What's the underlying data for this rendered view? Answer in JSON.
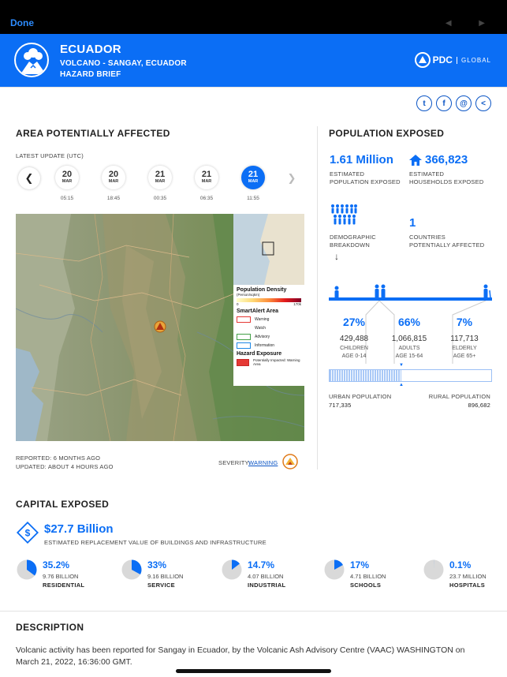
{
  "topbar": {
    "done_label": "Done"
  },
  "header": {
    "title": "ECUADOR",
    "subtitle": "VOLCANO - SANGAY, ECUADOR",
    "subtitle2": "HAZARD BRIEF",
    "brand": "PDC",
    "brand_tag": "GLOBAL"
  },
  "share": {
    "twitter": "t",
    "facebook": "f",
    "email": "@",
    "share": "<"
  },
  "area": {
    "title": "AREA POTENTIALLY AFFECTED",
    "latest_update": "LATEST UPDATE (UTC)",
    "timeline": [
      {
        "day": "20",
        "month": "MAR",
        "time": "05:15",
        "active": false
      },
      {
        "day": "20",
        "month": "MAR",
        "time": "18:45",
        "active": false
      },
      {
        "day": "21",
        "month": "MAR",
        "time": "00:35",
        "active": false
      },
      {
        "day": "21",
        "month": "MAR",
        "time": "06:35",
        "active": false
      },
      {
        "day": "21",
        "month": "MAR",
        "time": "11:55",
        "active": true
      }
    ],
    "reported": "REPORTED: 6 MONTHS AGO",
    "updated": "UPDATED: ABOUT 4 HOURS AGO",
    "severity_label": "SEVERITY:",
    "severity_value": "WARNING"
  },
  "legend": {
    "pop_density": "Population Density",
    "pop_unit": "(Person/sqkm)",
    "scale_min": "0",
    "scale_max": "170k",
    "smartalert": "SmartAlert Area",
    "items": [
      {
        "label": "Warning",
        "color": "#e53935"
      },
      {
        "label": "Watch",
        "color": "#ffffff"
      },
      {
        "label": "Advisory",
        "color": "#43a047"
      },
      {
        "label": "Information",
        "color": "#1e88e5"
      }
    ],
    "hazard_exposure": "Hazard Exposure",
    "impacted_label": "Potentially Impacted: Warning Area"
  },
  "population": {
    "title": "POPULATION EXPOSED",
    "estimated_value": "1.61 Million",
    "estimated_label": "ESTIMATED POPULATION EXPOSED",
    "households_value": "366,823",
    "households_label": "ESTIMATED HOUSEHOLDS EXPOSED",
    "demographic_label": "DEMOGRAPHIC BREAKDOWN",
    "countries_value": "1",
    "countries_label": "COUNTRIES POTENTIALLY AFFECTED",
    "ages": [
      {
        "pct": "27%",
        "count": "429,488",
        "group": "CHILDREN",
        "range": "AGE 0-14"
      },
      {
        "pct": "66%",
        "count": "1,066,815",
        "group": "ADULTS",
        "range": "AGE 15-64"
      },
      {
        "pct": "7%",
        "count": "117,713",
        "group": "ELDERLY",
        "range": "AGE 65+"
      }
    ],
    "urban_label": "URBAN POPULATION",
    "urban_value": "717,335",
    "rural_label": "RURAL POPULATION",
    "rural_value": "896,682",
    "urban_fraction": 0.444
  },
  "capital": {
    "title": "CAPITAL EXPOSED",
    "total": "$27.7 Billion",
    "total_label": "ESTIMATED REPLACEMENT VALUE OF BUILDINGS AND INFRASTRUCTURE",
    "items": [
      {
        "pct": "35.2%",
        "value": "9.76 BILLION",
        "name": "RESIDENTIAL",
        "fraction": 0.352
      },
      {
        "pct": "33%",
        "value": "9.16 BILLION",
        "name": "SERVICE",
        "fraction": 0.33
      },
      {
        "pct": "14.7%",
        "value": "4.07 BILLION",
        "name": "INDUSTRIAL",
        "fraction": 0.147
      },
      {
        "pct": "17%",
        "value": "4.71 BILLION",
        "name": "SCHOOLS",
        "fraction": 0.17
      },
      {
        "pct": "0.1%",
        "value": "23.7 MILLION",
        "name": "HOSPITALS",
        "fraction": 0.001
      }
    ]
  },
  "description": {
    "title": "DESCRIPTION",
    "text": "Volcanic activity has been reported for Sangay in Ecuador, by the Volcanic Ash Advisory Centre (VAAC) WASHINGTON on March 21, 2022, 16:36:00 GMT."
  },
  "colors": {
    "accent": "#0b6ef5",
    "header_bg": "#0b6ef5"
  }
}
